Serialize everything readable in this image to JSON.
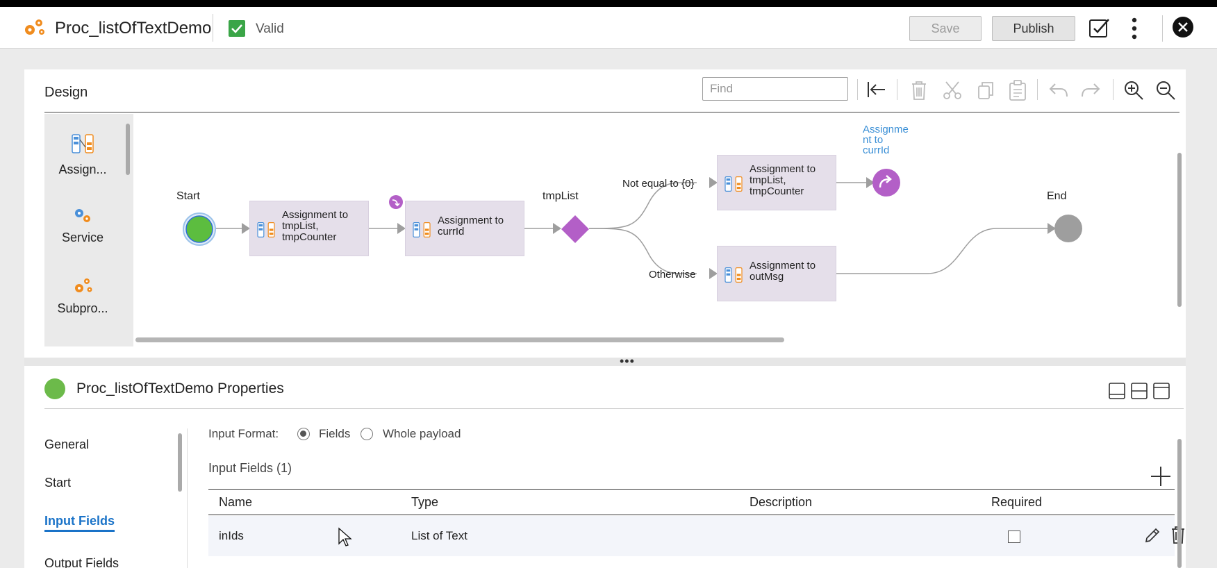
{
  "header": {
    "title": "Proc_listOfTextDemo",
    "status": "Valid",
    "save_label": "Save",
    "publish_label": "Publish"
  },
  "design": {
    "title": "Design",
    "find_placeholder": "Find",
    "palette": [
      "Assign...",
      "Service",
      "Subpro..."
    ],
    "nodes": {
      "start": "Start",
      "task1": [
        "Assignment to",
        "tmpList,",
        "tmpCounter"
      ],
      "task2": [
        "Assignment to",
        "currId"
      ],
      "decision": "tmpList",
      "branch1_label": "Not equal to {0}",
      "branch2_label": "Otherwise",
      "task3": [
        "Assignment to",
        "tmpList,",
        "tmpCounter"
      ],
      "task4": [
        "Assignment to",
        "outMsg"
      ],
      "jump_label": [
        "Assignme",
        "nt to",
        "currId"
      ],
      "end": "End"
    }
  },
  "properties": {
    "title": "Proc_listOfTextDemo Properties",
    "nav": [
      "General",
      "Start",
      "Input Fields",
      "Output Fields"
    ],
    "active_nav": "Input Fields",
    "input_format_label": "Input Format:",
    "format_options": [
      "Fields",
      "Whole payload"
    ],
    "input_fields_heading": "Input Fields (1)",
    "columns": [
      "Name",
      "Type",
      "Description",
      "Required"
    ],
    "rows": [
      {
        "name": "inIds",
        "type": "List of Text",
        "description": "",
        "required": false
      }
    ]
  },
  "colors": {
    "valid_green": "#3aa547",
    "start_green": "#6cba4a",
    "decision_purple": "#b35fc7",
    "task_fill": "#e5dfea",
    "link_blue": "#3a8fd6",
    "accent_blue": "#1a73c8"
  }
}
